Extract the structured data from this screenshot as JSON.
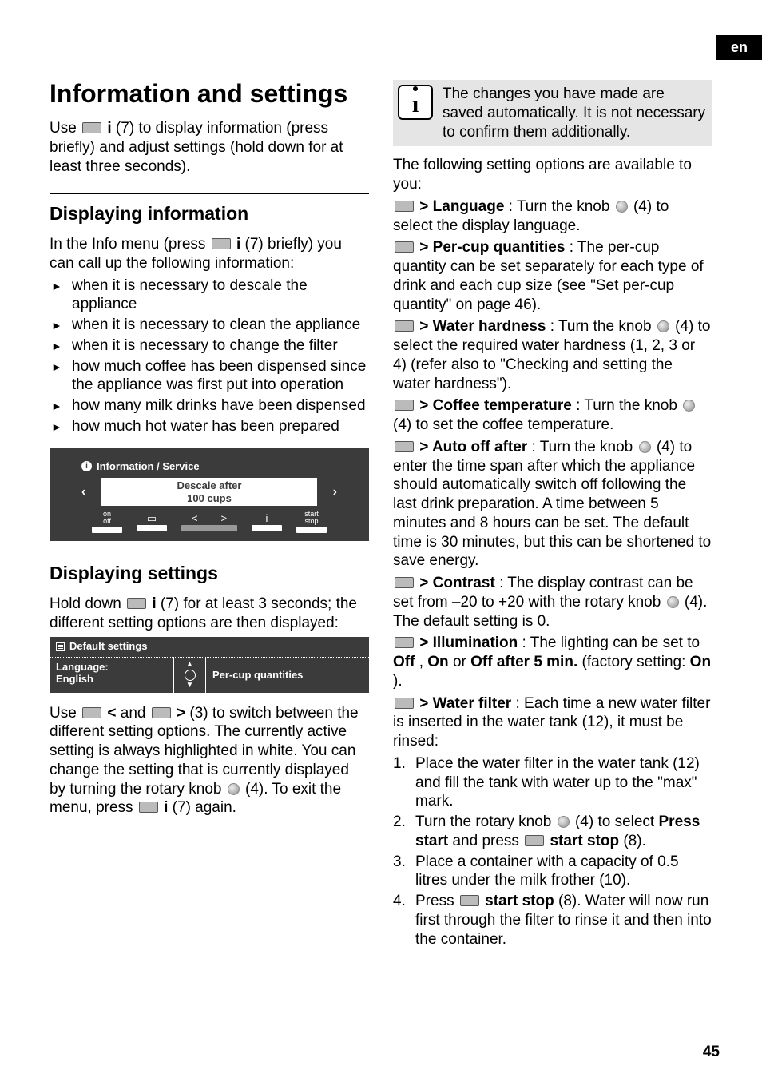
{
  "lang_tab": "en",
  "page_number": "45",
  "left": {
    "h1": "Information and settings",
    "intro_a": "Use ",
    "intro_b": " i",
    "intro_c": " (7) to display information (press briefly) and adjust settings (hold down for at least three seconds).",
    "h2a": "Displaying information",
    "info_lead_a": "In the Info menu (press ",
    "info_lead_b": " i",
    "info_lead_c": " (7) briefly) you can call up the following information:",
    "bullets": [
      "when it is necessary to descale the appliance",
      "when it is necessary to clean the appliance",
      "when it is necessary to change the filter",
      "how much coffee has been dispensed since the appliance was first put into operation",
      "how many milk drinks have been dispensed",
      "how much hot water has been prepared"
    ],
    "disp": {
      "title": "Information / Service",
      "box_line1": "Descale after",
      "box_line2": "100 cups",
      "k_on": "on",
      "k_off": "off",
      "k_start": "start",
      "k_stop": "stop",
      "k_i": "i"
    },
    "h2b": "Displaying settings",
    "settings_lead_a": "Hold down ",
    "settings_lead_b": " i",
    "settings_lead_c": " (7) for at least 3 seconds; the different setting options are then displayed:",
    "settings_panel": {
      "header": "Default settings",
      "left_line1": "Language:",
      "left_line2": "English",
      "right": "Per-cup quantities"
    },
    "after_a": "Use ",
    "after_lt": " <",
    "after_mid": " and ",
    "after_gt": " >",
    "after_b": " (3) to switch between the different setting options. The currently active setting is always highlighted in white. You can change the setting that is currently displayed by turning the rotary knob ",
    "after_c": " (4). To exit the menu, press ",
    "after_d": " i",
    "after_e": " (7) again."
  },
  "right": {
    "callout": "The changes you have made are saved automatically. It is not necessary to confirm them additionally.",
    "lead": "The following setting options are available to you:",
    "opts": {
      "lang_label": " > Language",
      "lang_text": ": Turn the knob ",
      "lang_text2": " (4) to select the display language.",
      "pcq_label": " > Per-cup quantities",
      "pcq_text": ": The per-cup quantity can be set separately for each type of drink and each cup size (see \"Set per-cup quantity\" on page 46).",
      "wh_label": " > Water hardness",
      "wh_text": ": Turn the knob ",
      "wh_text2": " (4) to select the required water hardness (1, 2, 3 or 4) (refer also to \"Checking and setting the water hardness\").",
      "ct_label": " > Coffee temperature",
      "ct_text": ": Turn the knob ",
      "ct_text2": " (4) to set the coffee temperature.",
      "ao_label": " > Auto off after",
      "ao_text": ": Turn the knob ",
      "ao_text2": " (4) to enter the time span after which the appliance should automatically switch off following the last drink preparation. A time between 5 minutes and 8 hours can be set. The default time is 30 minutes, but this can be shortened to save energy.",
      "co_label": " > Contrast",
      "co_text": ": The display contrast can be set from –20 to +20 with the rotary knob ",
      "co_text2": " (4). The default setting is 0.",
      "il_label": " > Illumination",
      "il_text_a": ": The lighting can be set to ",
      "il_off": "Off",
      "il_text_b": ", ",
      "il_on": "On",
      "il_text_c": " or ",
      "il_after5": "Off after 5 min.",
      "il_text_d": " (factory setting: ",
      "il_on2": "On",
      "il_text_e": ").",
      "wf_label": " > Water filter",
      "wf_text": ": Each time a new water filter is inserted in the water tank (12), it must be rinsed:"
    },
    "steps": [
      {
        "n": "1.",
        "t": "Place the water filter in the water tank (12) and fill the tank with water up to the \"max\" mark."
      },
      {
        "n": "2.",
        "pre": "Turn the rotary knob ",
        "mid": " (4) to select ",
        "press_start": "Press start",
        "andpress": " and press ",
        "startstop": " start stop",
        "tail": " (8)."
      },
      {
        "n": "3.",
        "t": "Place a container with a capacity of 0.5 litres under the milk frother (10)."
      },
      {
        "n": "4.",
        "pre": "Press ",
        "startstop": " start stop",
        "tail": " (8). Water will now run first through the filter to rinse it and then into the container."
      }
    ]
  }
}
